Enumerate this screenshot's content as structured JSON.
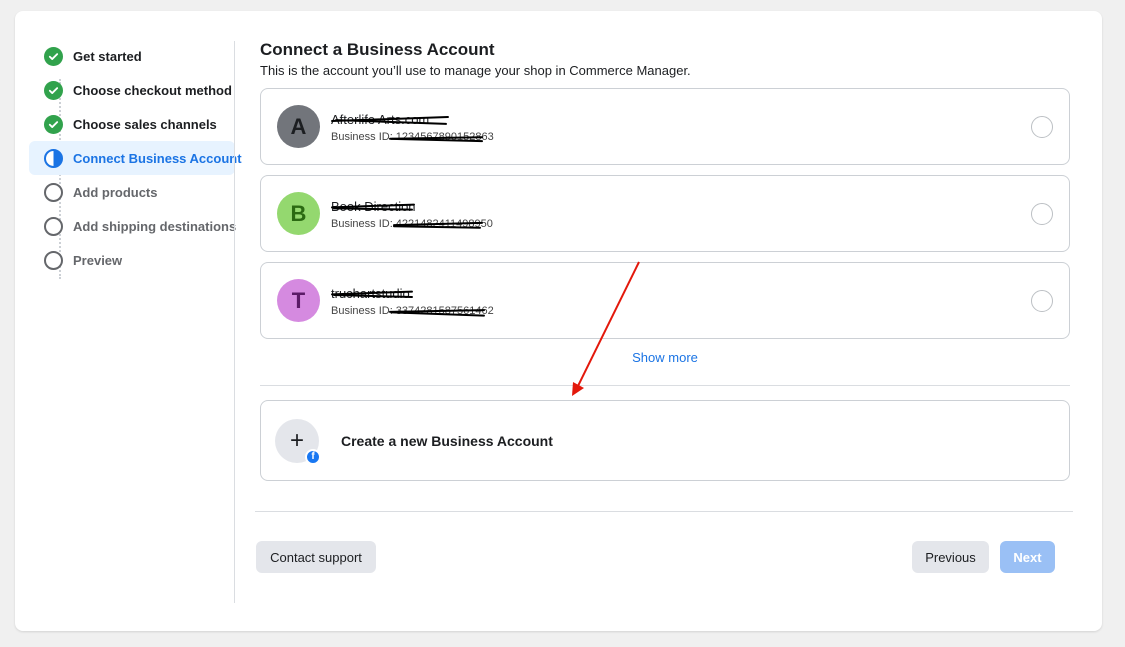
{
  "stepper": {
    "steps": [
      {
        "label": "Get started",
        "state": "done"
      },
      {
        "label": "Choose checkout method",
        "state": "done"
      },
      {
        "label": "Choose sales channels",
        "state": "done"
      },
      {
        "label": "Connect Business Account",
        "state": "active"
      },
      {
        "label": "Add products",
        "state": "todo"
      },
      {
        "label": "Add shipping destinations",
        "state": "todo"
      },
      {
        "label": "Preview",
        "state": "todo"
      }
    ]
  },
  "main": {
    "title": "Connect a Business Account",
    "subtitle": "This is the account you’ll use to manage your shop in Commerce Manager.",
    "accounts": [
      {
        "initial": "A",
        "name": "Afterlife Arts.com",
        "id_label": "Business ID: 1234567890152863",
        "avatar_bg": "#72757b",
        "avatar_fg": "#1c1e21"
      },
      {
        "initial": "B",
        "name": "Book Direction",
        "id_label": "Business ID: 4221482411498950",
        "avatar_bg": "#94d86f",
        "avatar_fg": "#2b6a12"
      },
      {
        "initial": "T",
        "name": "truchartstudio",
        "id_label": "Business ID: 3374281587561462",
        "avatar_bg": "#d58ae0",
        "avatar_fg": "#5b1b67"
      }
    ],
    "show_more": "Show more",
    "create_label": "Create a new Business Account",
    "create_icon": "+",
    "fb_badge": "f"
  },
  "footer": {
    "contact_label": "Contact support",
    "previous_label": "Previous",
    "next_label": "Next"
  },
  "colors": {
    "accent": "#1b74e4",
    "done": "#31a24c",
    "annotation_arrow": "#e3180b"
  }
}
